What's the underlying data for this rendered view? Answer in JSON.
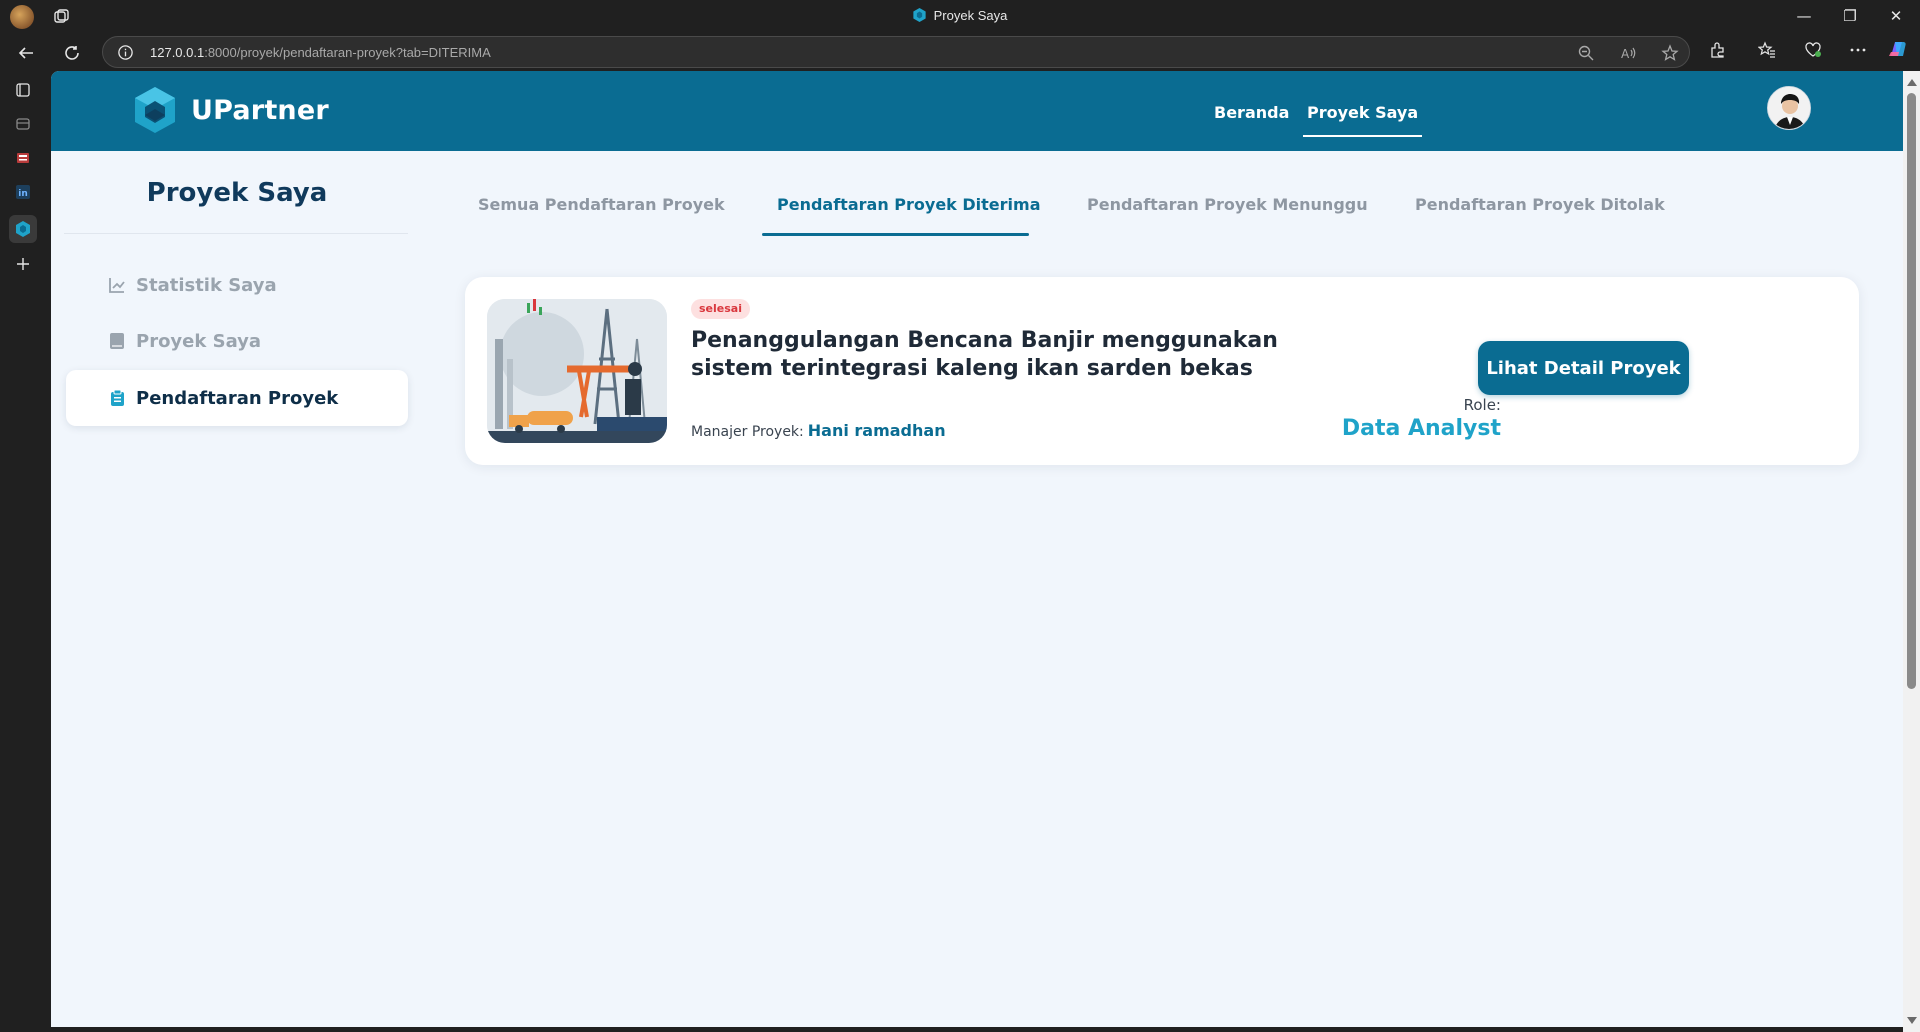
{
  "browser": {
    "tab_title": "Proyek Saya",
    "url_host": "127.0.0.1",
    "url_rest": ":8000/proyek/pendaftaran-proyek?tab=DITERIMA"
  },
  "site": {
    "brand": "UPartner",
    "nav": {
      "home": "Beranda",
      "my_projects": "Proyek Saya"
    }
  },
  "sidebar": {
    "title": "Proyek Saya",
    "items": [
      {
        "label": "Statistik Saya",
        "icon": "chart-line-icon"
      },
      {
        "label": "Proyek Saya",
        "icon": "book-icon"
      },
      {
        "label": "Pendaftaran Proyek",
        "icon": "clipboard-icon"
      }
    ]
  },
  "tabs": [
    {
      "label": "Semua Pendaftaran Proyek"
    },
    {
      "label": "Pendaftaran Proyek Diterima"
    },
    {
      "label": "Pendaftaran Proyek Menunggu"
    },
    {
      "label": "Pendaftaran Proyek Ditolak"
    }
  ],
  "project": {
    "status": "selesai",
    "title": "Penanggulangan Bencana Banjir menggunakan sistem terintegrasi kaleng ikan sarden bekas",
    "manager_label": "Manajer Proyek:",
    "manager_name": "Hani ramadhan",
    "role_label": "Role:",
    "role_value": "Data Analyst",
    "detail_button": "Lihat Detail Proyek"
  },
  "colors": {
    "primary": "#0a6c92",
    "accent": "#1fa3c9",
    "badge_bg": "#fde0e0",
    "badge_text": "#d9373d",
    "page_bg": "#f1f6fc"
  }
}
